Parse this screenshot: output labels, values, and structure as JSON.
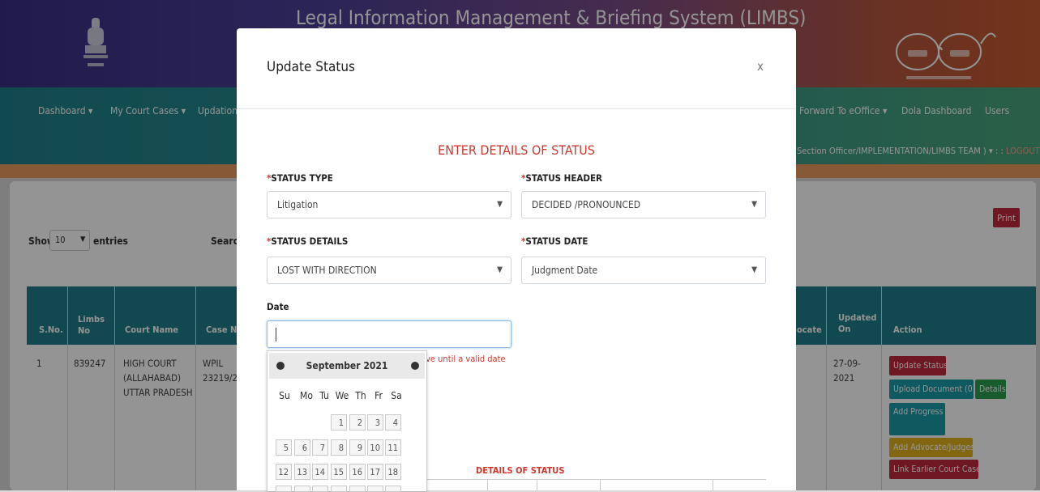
{
  "site": {
    "title": "Legal Information Management & Briefing System (LIMBS)",
    "nav_items": [
      {
        "label": "Dashboard ▾"
      },
      {
        "label": "My Court Cases ▾"
      },
      {
        "label": "Updation"
      },
      {
        "label": "Forward To eOffice ▾"
      },
      {
        "label": "Dola Dashboard"
      },
      {
        "label": "Users"
      }
    ],
    "user_line": "Section Officer/IMPLEMENTATION/LIMBS TEAM ) ▾ : : ",
    "logout_label": "LOGOUT"
  },
  "listing": {
    "print_label": "Print",
    "show_label": "Show",
    "entries_value": "10",
    "entries_label": "entries",
    "search_label": "Searc",
    "columns": {
      "sno": "S.No.",
      "limbs_no": "Limbs No",
      "court_name": "Court Name",
      "case_no": "Case No",
      "advocate": "ocate",
      "updated_on": "Updated On",
      "action": "Action"
    },
    "row": {
      "sno": "1",
      "limbs_no": "839247",
      "court_name": "HIGH COURT (ALLAHABAD) UTTAR PRADESH",
      "case_no": "WPIL 23219/2(",
      "updated_on": "27-09-2021"
    },
    "actions": {
      "update_status": "Update Status",
      "upload_document": "Upload Document (0)",
      "details": "Details",
      "add_progress": "Add Progress",
      "add_advocate": "Add Advocate/Judges",
      "link_earlier": "Link Earlier Court Case"
    }
  },
  "modal": {
    "title": "Update Status",
    "close_label": "x",
    "form_title": "ENTER DETAILS OF STATUS",
    "status_type": {
      "label": "STATUS TYPE",
      "value": "Litigation"
    },
    "status_header": {
      "label": "STATUS HEADER",
      "value": "DECIDED /PRONOUNCED"
    },
    "status_details": {
      "label": "STATUS DETAILS",
      "value": "LOST WITH DIRECTION"
    },
    "status_date": {
      "label": "STATUS DATE",
      "value": "Judgment Date"
    },
    "date_label": "Date",
    "date_value": "",
    "date_hint": "ave until a valid date",
    "details_title": "DETAILS OF STATUS"
  },
  "datepicker": {
    "month_label": "September 2021",
    "weekdays": [
      "Su",
      "Mo",
      "Tu",
      "We",
      "Th",
      "Fr",
      "Sa"
    ],
    "days": [
      "1",
      "2",
      "3",
      "4",
      "5",
      "6",
      "7",
      "8",
      "9",
      "10",
      "11",
      "12",
      "13",
      "14",
      "15",
      "16",
      "17",
      "18"
    ]
  },
  "colors": {
    "accent_red": "#d0372c",
    "teal_header": "#1f7d88",
    "btn_red": "#c0283c",
    "btn_teal": "#1a9aa8",
    "btn_green": "#2e9e4f",
    "btn_yellow": "#e2b21c"
  },
  "icons": {
    "emblem": "national-emblem-icon",
    "right_logo": "swachh-bharat-logo-icon",
    "prev": "chevron-left-icon",
    "next": "chevron-right-icon",
    "dropdown": "chevron-down-icon"
  }
}
